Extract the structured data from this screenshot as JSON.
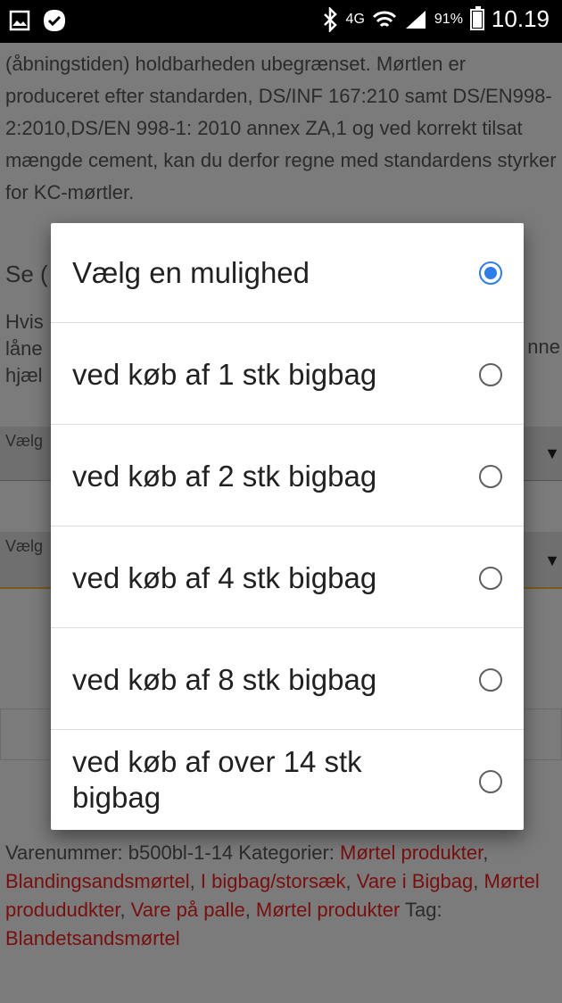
{
  "status_bar": {
    "network": "4G",
    "battery_percent": "91%",
    "time": "10.19"
  },
  "background": {
    "paragraph": "(åbningstiden) holdbarheden ubegrænset. Mørtlen er produceret efter standarden, DS/INF 167:210 samt DS/EN998-2:2010,DS/EN 998-1: 2010 annex ZA,1 og ved korrekt tilsat mængde cement, kan du derfor regne med standardens styrker for KC-mørtler.",
    "se_heading": "Se (",
    "hvis_lines": [
      "Hvis",
      "låne",
      "hjæl"
    ],
    "hvis_right_fragment": "nne",
    "select_label_1": "Vælg",
    "select_label_2": "Vælg",
    "meta_prefix": "Varenummer: b500bl-1-14 Kategorier: ",
    "categories": [
      "Mørtel produkter",
      "Blandingsandsmørtel",
      "I bigbag/storsæk",
      "Vare i Bigbag",
      "Mørtel prodududkter",
      "Vare på palle",
      "Mørtel produkter"
    ],
    "tag_label": " Tag: ",
    "tag": "Blandetsandsmørtel"
  },
  "dialog": {
    "selected_index": 0,
    "options": [
      "Vælg en mulighed",
      "ved køb af 1 stk bigbag",
      "ved køb af 2 stk bigbag",
      "ved køb af 4 stk bigbag",
      "ved køb af 8 stk bigbag",
      "ved køb af over 14 stk bigbag"
    ]
  }
}
